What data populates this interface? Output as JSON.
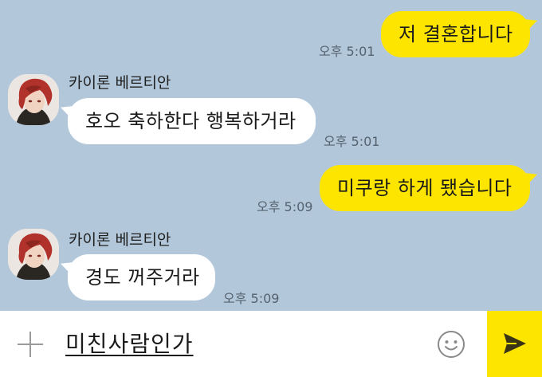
{
  "chat": {
    "messages": [
      {
        "from": "me",
        "text": "저 결혼합니다",
        "time": "오후 5:01"
      },
      {
        "from": "other",
        "sender": "카이론 베르티안",
        "text": "호오 축하한다 행복하거라",
        "time": "오후 5:01"
      },
      {
        "from": "me",
        "text": "미쿠랑 하게 됐습니다",
        "time": "오후 5:09"
      },
      {
        "from": "other",
        "sender": "카이론 베르티안",
        "text": "경도 꺼주거라",
        "time": "오후 5:09"
      }
    ]
  },
  "input": {
    "value": "미친사람인가"
  },
  "colors": {
    "background": "#b2c7d9",
    "my_bubble": "#fee500",
    "other_bubble": "#ffffff",
    "send_button": "#fee500"
  },
  "icons": {
    "attach": "plus-icon",
    "emoticon": "smiley-icon",
    "send": "paper-plane-icon"
  }
}
